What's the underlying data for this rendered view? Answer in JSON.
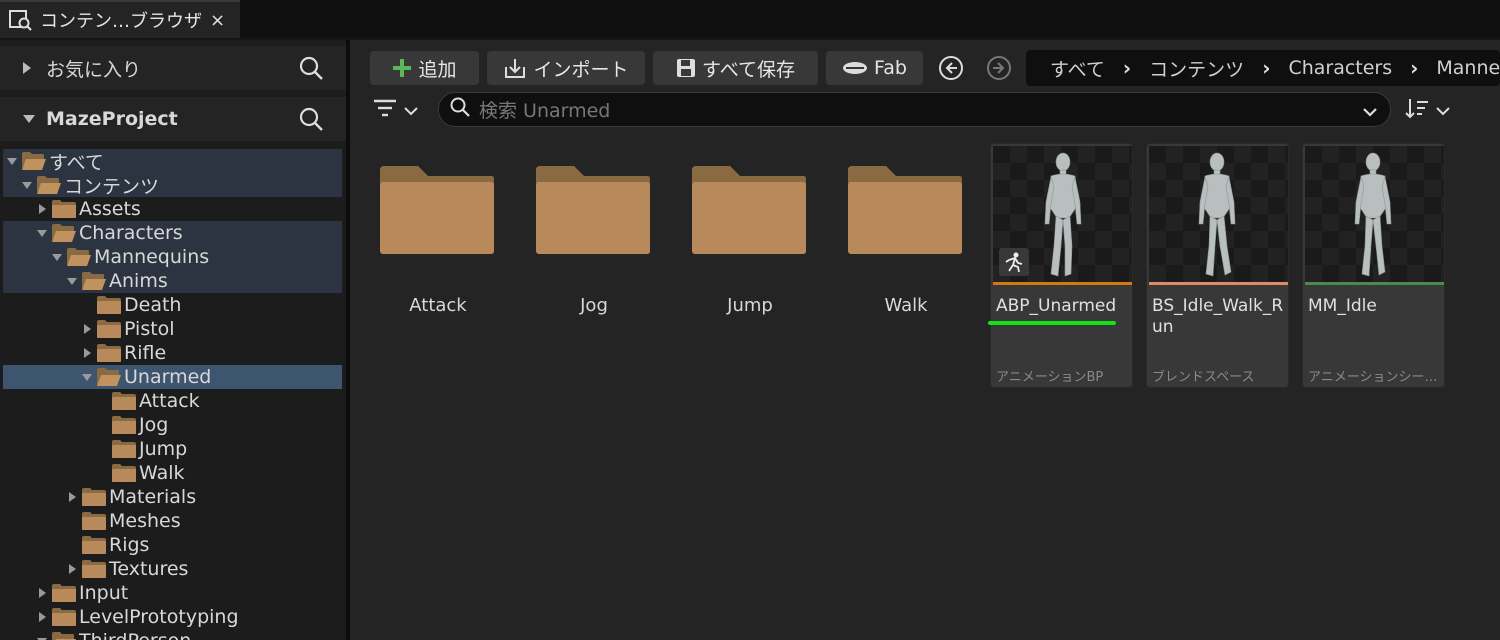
{
  "tab": {
    "label": "コンテン…ブラウザ",
    "close": "×",
    "icon": "content-browser-icon"
  },
  "left_panel": {
    "favorites": {
      "label": "お気に入り",
      "icon": "search-icon"
    },
    "project": {
      "label": "MazeProject",
      "icon": "search-icon"
    },
    "tree": [
      {
        "label": "すべて",
        "state": "expanded"
      },
      {
        "label": "コンテンツ",
        "state": "expanded"
      },
      {
        "label": "Assets",
        "state": "collapsed"
      },
      {
        "label": "Characters",
        "state": "expanded"
      },
      {
        "label": "Mannequins",
        "state": "expanded"
      },
      {
        "label": "Anims",
        "state": "expanded"
      },
      {
        "label": "Death",
        "state": "leaf"
      },
      {
        "label": "Pistol",
        "state": "collapsed"
      },
      {
        "label": "Rifle",
        "state": "collapsed"
      },
      {
        "label": "Unarmed",
        "state": "expanded",
        "selected": true
      },
      {
        "label": "Attack",
        "state": "leaf"
      },
      {
        "label": "Jog",
        "state": "leaf"
      },
      {
        "label": "Jump",
        "state": "leaf"
      },
      {
        "label": "Walk",
        "state": "leaf"
      },
      {
        "label": "Materials",
        "state": "collapsed"
      },
      {
        "label": "Meshes",
        "state": "leaf"
      },
      {
        "label": "Rigs",
        "state": "leaf"
      },
      {
        "label": "Textures",
        "state": "collapsed"
      },
      {
        "label": "Input",
        "state": "collapsed"
      },
      {
        "label": "LevelPrototyping",
        "state": "collapsed"
      },
      {
        "label": "ThirdPerson",
        "state": "expanded"
      }
    ]
  },
  "toolbar": {
    "add": "追加",
    "import": "インポート",
    "save_all": "すべて保存",
    "fab": "Fab",
    "back_icon": "back-arrow-icon",
    "forward_icon": "forward-arrow-icon"
  },
  "breadcrumb": [
    "すべて",
    "コンテンツ",
    "Characters",
    "Manne"
  ],
  "search": {
    "placeholder": "検索 Unarmed"
  },
  "folders": [
    "Attack",
    "Jog",
    "Jump",
    "Walk"
  ],
  "assets": [
    {
      "name": "ABP_Unarmed",
      "type": "アニメーションBP",
      "color": "#d07a10",
      "has_badge": true
    },
    {
      "name": "BS_Idle_Walk_Run",
      "type": "ブレンドスペース",
      "color": "#e08a6a",
      "has_badge": false
    },
    {
      "name": "MM_Idle",
      "type": "アニメーションシー…",
      "color": "#4a8a4a",
      "has_badge": false
    }
  ],
  "colors": {
    "folder": "#b8895a",
    "selection": "#3e556f",
    "highlight": "#2b3440",
    "add_plus": "#5ab85a",
    "underline": "#16e016"
  }
}
